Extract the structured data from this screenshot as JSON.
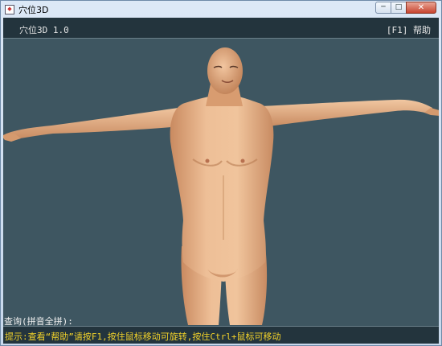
{
  "window": {
    "title": "穴位3D",
    "minimize": "─",
    "maximize": "□",
    "close": "✕"
  },
  "header": {
    "app_name": "穴位3D 1.0",
    "help_hint": "[F1] 帮助"
  },
  "query": {
    "prompt": "查询(拼音全拼):_"
  },
  "status": {
    "tip": "提示:查看“帮助”请按F1,按住鼠标移动可旋转,按住Ctrl+鼠标可移动"
  },
  "colors": {
    "viewport_bg": "#3e5661",
    "bar_bg": "#23343d",
    "tip_text": "#f2d22a",
    "skin": "#e7b58d"
  }
}
